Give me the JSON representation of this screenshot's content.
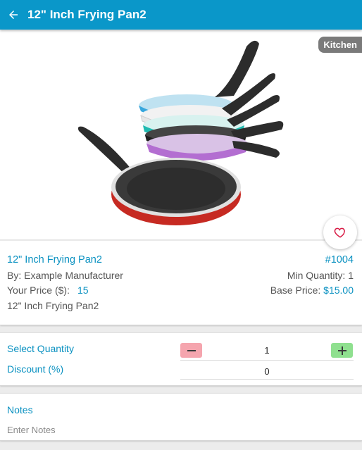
{
  "appbar": {
    "title": "12\" Inch Frying Pan2"
  },
  "image": {
    "category_badge": "Kitchen"
  },
  "product": {
    "name": "12\" Inch Frying Pan2",
    "number": "#1004",
    "manufacturer": "By: Example Manufacturer",
    "min_quantity": "Min Quantity: 1",
    "your_price_label": "Your Price ($):",
    "your_price_value": "15",
    "base_price_label": "Base Price:",
    "base_price_value": "$15.00",
    "description": "12\" Inch Frying Pan2"
  },
  "order": {
    "select_quantity_label": "Select Quantity",
    "quantity_value": "1",
    "discount_label": "Discount (%)",
    "discount_value": "0"
  },
  "notes": {
    "label": "Notes",
    "placeholder": "Enter Notes"
  },
  "colors": {
    "accent": "#0a97c9",
    "minus_button": "#f5a5ae",
    "plus_button": "#8fe08f",
    "badge": "#7a7a7a"
  },
  "icons": {
    "back": "arrow-left-icon",
    "favorite": "heart-outline-icon",
    "minus": "minus-icon",
    "plus": "plus-icon"
  }
}
